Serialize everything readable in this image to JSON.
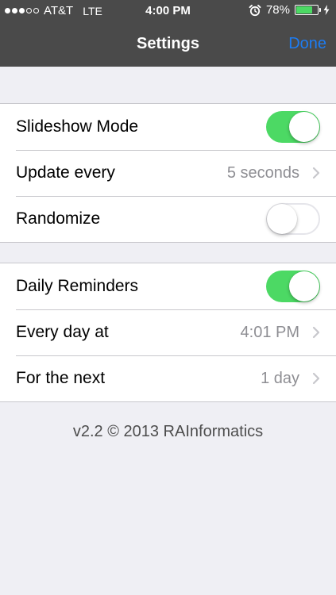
{
  "status_bar": {
    "signal_strength": 3,
    "signal_max": 5,
    "carrier": "AT&T",
    "network": "LTE",
    "time": "4:00 PM",
    "alarm_icon": "alarm-clock-icon",
    "battery_percent_text": "78%",
    "battery_level": 0.78,
    "charging_icon": "lightning-bolt-icon"
  },
  "nav": {
    "title": "Settings",
    "done_label": "Done"
  },
  "slideshow_group": {
    "slideshow_mode": {
      "label": "Slideshow Mode",
      "on": true
    },
    "update_every": {
      "label": "Update every",
      "value": "5 seconds"
    },
    "randomize": {
      "label": "Randomize",
      "on": false
    }
  },
  "reminders_group": {
    "daily_reminders": {
      "label": "Daily Reminders",
      "on": true
    },
    "every_day_at": {
      "label": "Every day at",
      "value": "4:01 PM"
    },
    "for_the_next": {
      "label": "For the next",
      "value": "1 day"
    }
  },
  "footer": {
    "text": "v2.2 © 2013 RAInformatics"
  },
  "colors": {
    "accent": "#1d7cf2",
    "toggle_on": "#4cd964",
    "nav_background": "#4a4a4a",
    "page_background": "#efeff4",
    "secondary_text": "#8e8e93"
  }
}
